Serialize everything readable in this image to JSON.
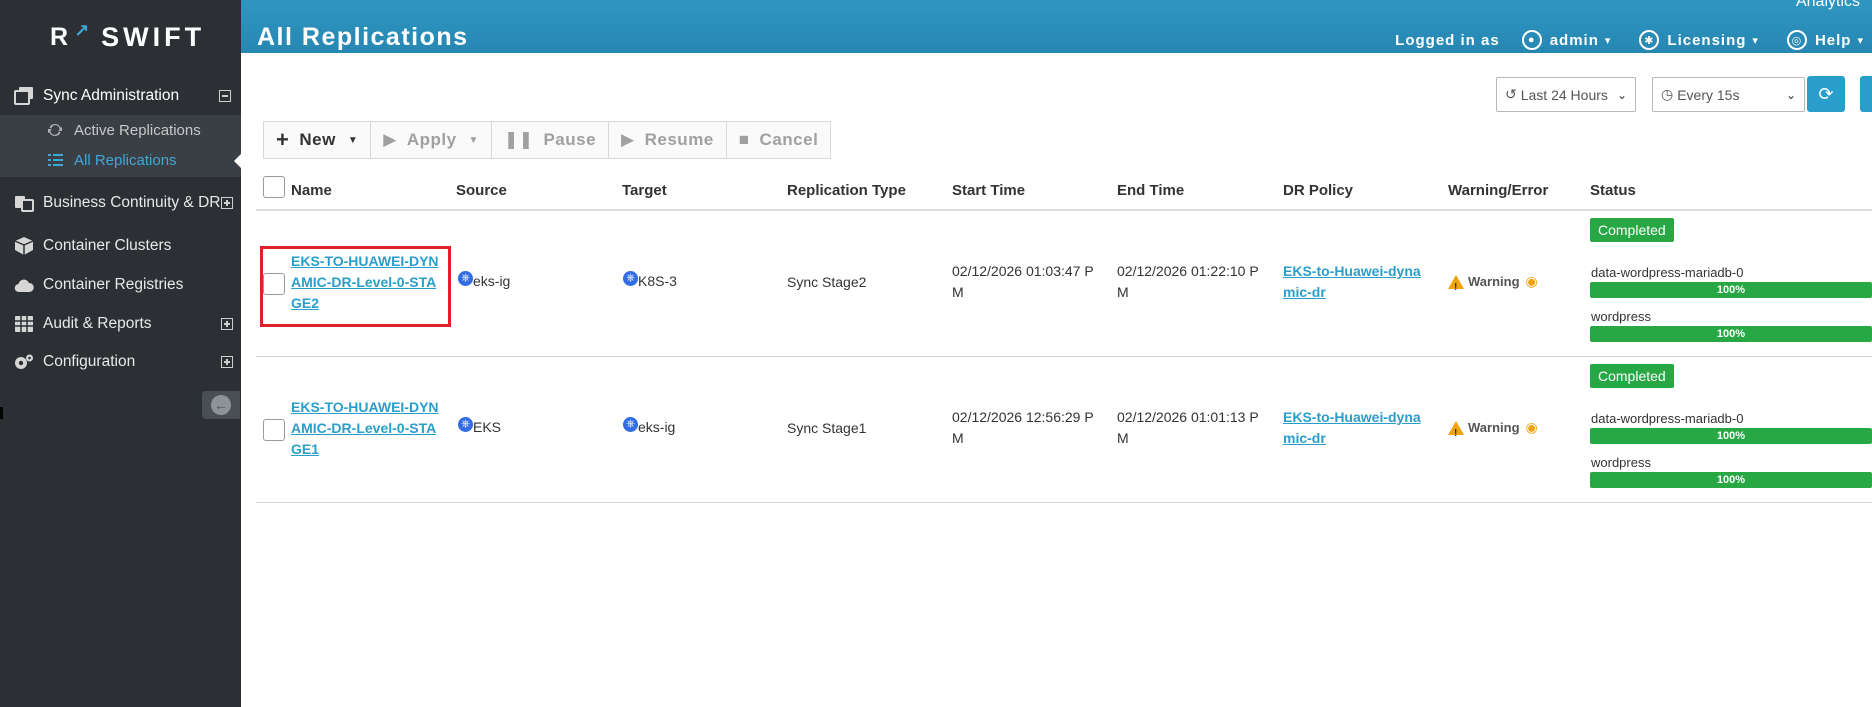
{
  "brand": {
    "name": "SWIFT",
    "r": "R"
  },
  "header": {
    "title": "All Replications",
    "analytics": "Analytics",
    "logged_in_label": "Logged in as",
    "user": "admin",
    "licensing": "Licensing",
    "help": "Help"
  },
  "sidebar": {
    "sync_admin": "Sync Administration",
    "active_replications": "Active Replications",
    "all_replications": "All Replications",
    "business_continuity": "Business Continuity & DR",
    "container_clusters": "Container Clusters",
    "container_registries": "Container Registries",
    "audit_reports": "Audit & Reports",
    "configuration": "Configuration"
  },
  "filters": {
    "time_range": "Last 24 Hours",
    "refresh_interval": "Every 15s"
  },
  "actions": {
    "new": "New",
    "apply": "Apply",
    "pause": "Pause",
    "resume": "Resume",
    "cancel": "Cancel"
  },
  "table": {
    "columns": {
      "name": "Name",
      "source": "Source",
      "target": "Target",
      "type": "Replication Type",
      "start": "Start Time",
      "end": "End Time",
      "policy": "DR Policy",
      "warning": "Warning/Error",
      "status": "Status"
    },
    "rows": [
      {
        "name_l1": "EKS-TO-HUAWEI-DYN",
        "name_l2": "AMIC-DR-Level-0-STA",
        "name_l3": "GE2",
        "source": "eks-ig",
        "target": "K8S-3",
        "type": "Sync Stage2",
        "start_l1": "02/12/2026 01:03:47 P",
        "start_l2": "M",
        "end_l1": "02/12/2026 01:22:10 P",
        "end_l2": "M",
        "policy_l1": "EKS-to-Huawei-dyna",
        "policy_l2": "mic-dr",
        "warning": "Warning",
        "status": "Completed",
        "task1": "data-wordpress-mariadb-0",
        "task1_pct": "100%",
        "task1_progress": 100,
        "task2": "wordpress",
        "task2_pct": "100%",
        "task2_progress": 100
      },
      {
        "name_l1": "EKS-TO-HUAWEI-DYN",
        "name_l2": "AMIC-DR-Level-0-STA",
        "name_l3": "GE1",
        "source": "EKS",
        "target": "eks-ig",
        "type": "Sync Stage1",
        "start_l1": "02/12/2026 12:56:29 P",
        "start_l2": "M",
        "end_l1": "02/12/2026 01:01:13 P",
        "end_l2": "M",
        "policy_l1": "EKS-to-Huawei-dyna",
        "policy_l2": "mic-dr",
        "warning": "Warning",
        "status": "Completed",
        "task1": "data-wordpress-mariadb-0",
        "task1_pct": "100%",
        "task1_progress": 100,
        "task2": "wordpress",
        "task2_pct": "100%",
        "task2_progress": 100
      }
    ]
  },
  "colors": {
    "header": "#2a8fbb",
    "sidebar": "#2c3035",
    "accent": "#2a9ecb",
    "success": "#28a745",
    "warning": "#f0a30a",
    "highlight": "#e0202a"
  }
}
